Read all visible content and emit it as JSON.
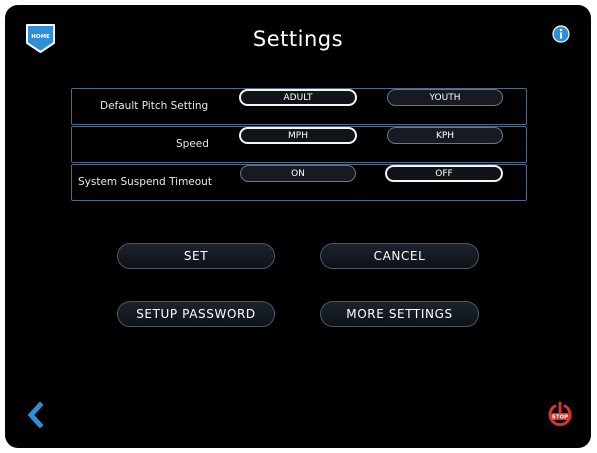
{
  "header": {
    "title": "Settings",
    "home_label": "HOME"
  },
  "settings": {
    "pitch": {
      "label": "Default Pitch Setting",
      "options": [
        "ADULT",
        "YOUTH"
      ],
      "selected": "ADULT"
    },
    "speed": {
      "label": "Speed",
      "options": [
        "MPH",
        "KPH"
      ],
      "selected": "MPH"
    },
    "suspend": {
      "label": "System Suspend Timeout",
      "options": [
        "ON",
        "OFF"
      ],
      "selected": "OFF"
    }
  },
  "actions": {
    "set": "SET",
    "cancel": "CANCEL",
    "setup_password": "SETUP PASSWORD",
    "more_settings": "MORE SETTINGS"
  },
  "footer": {
    "stop_label": "STOP"
  },
  "icons": {
    "home": "home-icon",
    "info": "info-icon",
    "back": "chevron-left-icon",
    "stop": "power-stop-icon"
  },
  "colors": {
    "accent": "#2f8fd6",
    "stop": "#d9342b",
    "background": "#000000"
  }
}
